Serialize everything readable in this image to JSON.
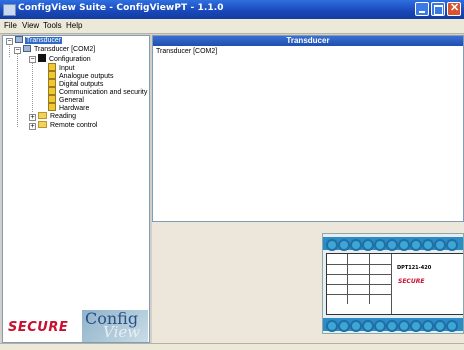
{
  "window": {
    "title": "ConfigView Suite - ConfigViewPT - 1.1.0"
  },
  "menu": {
    "items": [
      "File",
      "View",
      "Tools",
      "Help"
    ]
  },
  "tree": {
    "root": "Transducer",
    "device": "Transducer [COM2]",
    "configuration": "Configuration",
    "config_children": [
      "Input",
      "Analogue outputs",
      "Digital outputs",
      "Communication and security",
      "General",
      "Hardware"
    ],
    "reading": "Reading",
    "remote": "Remote control"
  },
  "right_pane": {
    "header": "Transducer",
    "content": "Transducer [COM2]"
  },
  "logo": {
    "brand": "SECURE",
    "product_top": "Config",
    "product_bottom": "View"
  },
  "device_image": {
    "model": "DPT121-420",
    "brand": "SECURE"
  },
  "colors": {
    "titlebar": "#1847b8",
    "selection": "#316ac5",
    "brand_red": "#c8102e",
    "terminal_blue": "#3ea6d6"
  }
}
